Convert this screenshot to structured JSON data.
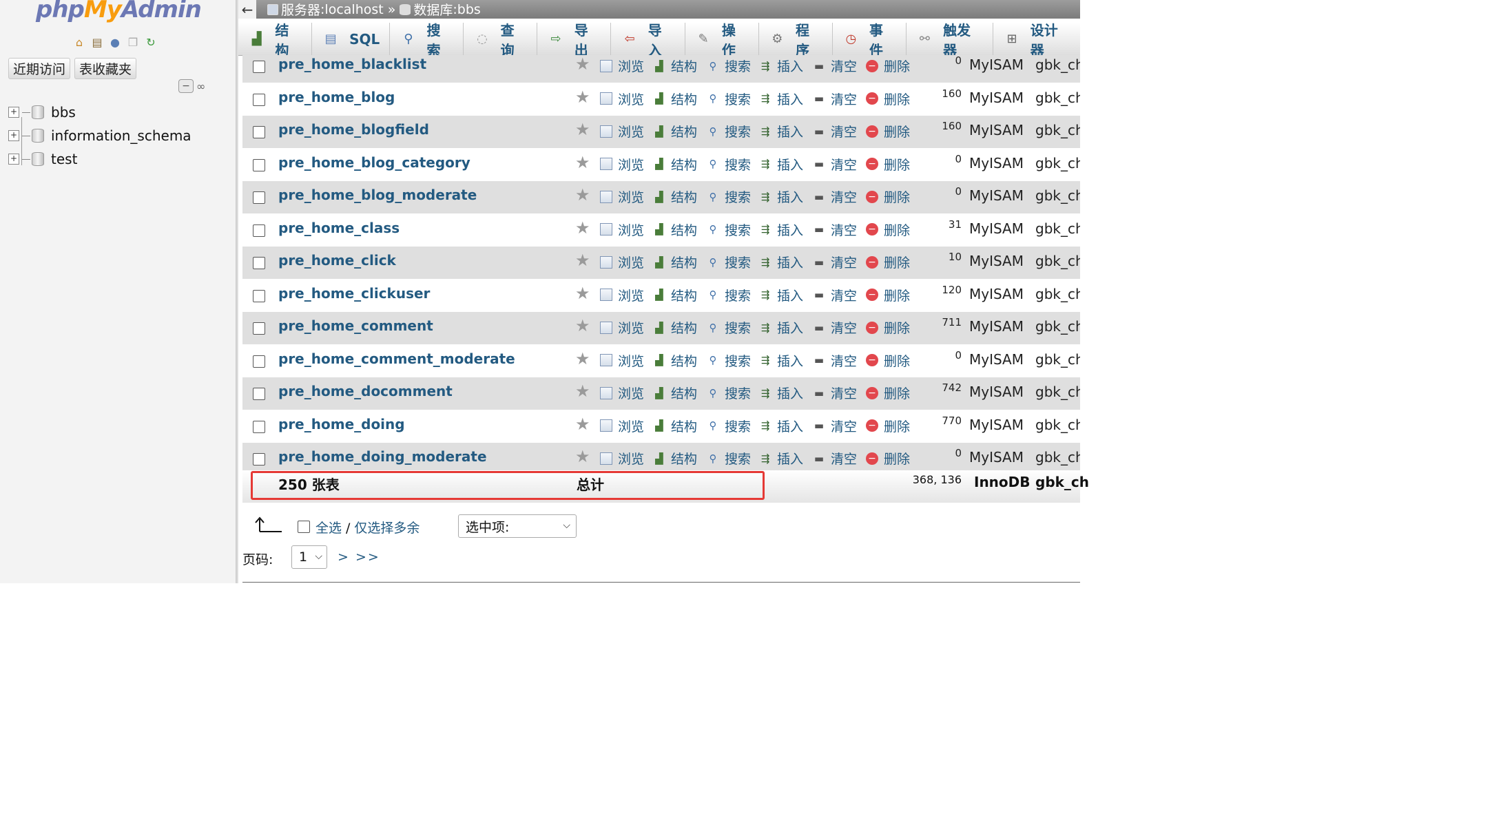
{
  "nav": {
    "logo": {
      "php": "php",
      "my": "My",
      "admin": "Admin"
    },
    "icons": [
      "home-icon",
      "exit-icon",
      "help-icon",
      "docs-icon",
      "reload-icon"
    ],
    "tabs": [
      "近期访问",
      "表收藏夹"
    ],
    "databases": [
      "bbs",
      "information_schema",
      "test"
    ]
  },
  "breadcrumb": {
    "server_label": "服务器",
    "server": "localhost",
    "sep": "»",
    "db_label": "数据库",
    "db": "bbs"
  },
  "tabs": [
    {
      "label": "结构",
      "icon": "structure-icon"
    },
    {
      "label": "SQL",
      "icon": "sql-icon"
    },
    {
      "label": "搜索",
      "icon": "search-icon"
    },
    {
      "label": "查询",
      "icon": "query-icon"
    },
    {
      "label": "导出",
      "icon": "export-icon"
    },
    {
      "label": "导入",
      "icon": "import-icon"
    },
    {
      "label": "操作",
      "icon": "wrench-icon"
    },
    {
      "label": "程序",
      "icon": "routines-icon"
    },
    {
      "label": "事件",
      "icon": "events-icon"
    },
    {
      "label": "触发器",
      "icon": "triggers-icon"
    },
    {
      "label": "设计器",
      "icon": "designer-icon"
    }
  ],
  "actions": {
    "browse": "浏览",
    "structure": "结构",
    "search": "搜索",
    "insert": "插入",
    "empty": "清空",
    "drop": "删除"
  },
  "tables": [
    {
      "name": "pre_home_blacklist",
      "rows": "0",
      "engine": "MyISAM",
      "collation": "gbk_ch"
    },
    {
      "name": "pre_home_blog",
      "rows": "160",
      "engine": "MyISAM",
      "collation": "gbk_ch"
    },
    {
      "name": "pre_home_blogfield",
      "rows": "160",
      "engine": "MyISAM",
      "collation": "gbk_ch"
    },
    {
      "name": "pre_home_blog_category",
      "rows": "0",
      "engine": "MyISAM",
      "collation": "gbk_ch"
    },
    {
      "name": "pre_home_blog_moderate",
      "rows": "0",
      "engine": "MyISAM",
      "collation": "gbk_ch"
    },
    {
      "name": "pre_home_class",
      "rows": "31",
      "engine": "MyISAM",
      "collation": "gbk_ch"
    },
    {
      "name": "pre_home_click",
      "rows": "10",
      "engine": "MyISAM",
      "collation": "gbk_ch"
    },
    {
      "name": "pre_home_clickuser",
      "rows": "120",
      "engine": "MyISAM",
      "collation": "gbk_ch"
    },
    {
      "name": "pre_home_comment",
      "rows": "711",
      "engine": "MyISAM",
      "collation": "gbk_ch"
    },
    {
      "name": "pre_home_comment_moderate",
      "rows": "0",
      "engine": "MyISAM",
      "collation": "gbk_ch"
    },
    {
      "name": "pre_home_docomment",
      "rows": "742",
      "engine": "MyISAM",
      "collation": "gbk_ch"
    },
    {
      "name": "pre_home_doing",
      "rows": "770",
      "engine": "MyISAM",
      "collation": "gbk_ch"
    },
    {
      "name": "pre_home_doing_moderate",
      "rows": "0",
      "engine": "MyISAM",
      "collation": "gbk_ch"
    }
  ],
  "summary": {
    "count": "250 张表",
    "label": "总计",
    "rows": "368, 136",
    "engine": "InnoDB",
    "collation": "gbk_ch"
  },
  "bottom": {
    "check_all": "全选",
    "slash": "/",
    "check_overhead": "仅选择多余",
    "with_selected": "选中项:",
    "page_label": "页码:",
    "page_value": "1",
    "page_next": "> >>"
  },
  "colors": {
    "link": "#235a81",
    "highlight": "#e53935",
    "row_alt": "#dfdfdf"
  }
}
